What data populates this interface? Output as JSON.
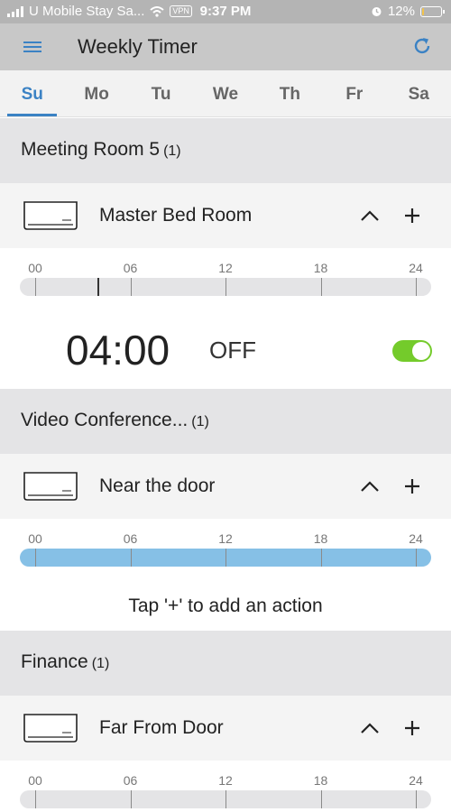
{
  "status_bar": {
    "carrier": "U Mobile Stay Sa...",
    "vpn": "VPN",
    "time": "9:37 PM",
    "battery": "12%",
    "battery_level": 0.12,
    "icons": [
      "signal-icon",
      "wifi-icon",
      "alarm-icon",
      "battery-icon"
    ]
  },
  "app_bar": {
    "title": "Weekly Timer",
    "icons": [
      "menu-icon",
      "refresh-icon"
    ],
    "accent_color": "#3b82c4"
  },
  "tabs": [
    {
      "label": "Su",
      "active": true
    },
    {
      "label": "Mo",
      "active": false
    },
    {
      "label": "Tu",
      "active": false
    },
    {
      "label": "We",
      "active": false
    },
    {
      "label": "Th",
      "active": false
    },
    {
      "label": "Fr",
      "active": false
    },
    {
      "label": "Sa",
      "active": false
    }
  ],
  "timeline_ticks": [
    "00",
    "06",
    "12",
    "18",
    "24"
  ],
  "groups": [
    {
      "name": "Meeting Room 5",
      "count": "(1)",
      "device": {
        "name": "Master Bed Room",
        "icon": "air-conditioner-icon"
      },
      "timeline": {
        "marker_hour": 4
      },
      "action": {
        "time": "04:00",
        "state": "OFF",
        "enabled": true,
        "toggle_color": "#74cb2b"
      }
    },
    {
      "name": "Video Conference...",
      "count": "(1)",
      "device": {
        "name": "Near the door",
        "icon": "air-conditioner-icon"
      },
      "timeline": {
        "fill_color": "#86c0e6"
      },
      "hint": "Tap '+' to add an action"
    },
    {
      "name": "Finance",
      "count": "(1)",
      "device": {
        "name": "Far From Door",
        "icon": "air-conditioner-icon"
      }
    }
  ]
}
